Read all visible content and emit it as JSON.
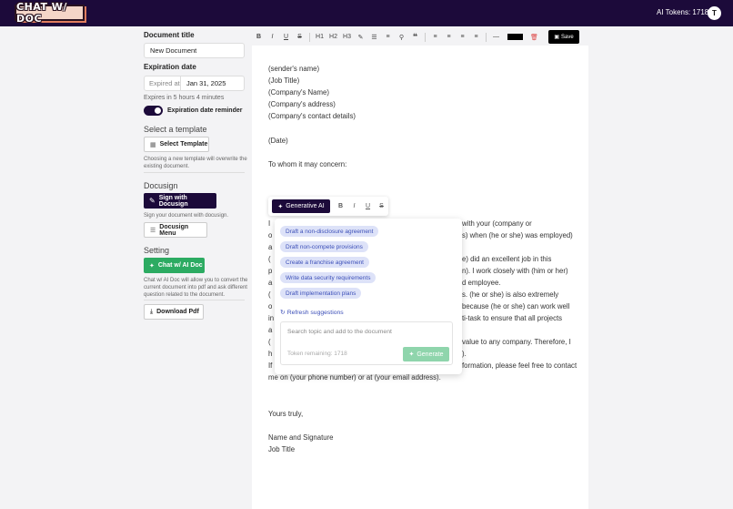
{
  "header": {
    "logo_text": "CHAT W/ DOC",
    "tokens_label": "AI Tokens: 1718",
    "avatar_initial": "T"
  },
  "sidebar": {
    "doc_title_label": "Document title",
    "doc_title_value": "New Document",
    "expiration_label": "Expiration date",
    "expired_at_label": "Expired at",
    "expiration_value": "Jan 31, 2025",
    "expires_in": "Expires in 5 hours 4 minutes",
    "reminder_label": "Expiration date reminder",
    "template_heading": "Select a template",
    "select_template_btn": "Select Template",
    "template_hint": "Choosing a new template will overwrite the existing document.",
    "docusign_heading": "Docusign",
    "sign_btn": "Sign with Docusign",
    "sign_hint": "Sign your document with docusign.",
    "docusign_menu_btn": "Docusign Menu",
    "setting_heading": "Setting",
    "chat_btn": "Chat w/ AI Doc",
    "chat_hint": "Chat w/ AI Doc will allow you to convert the current document into pdf and ask different question related to the document.",
    "download_btn": "Download Pdf"
  },
  "toolbar": {
    "bold": "B",
    "italic": "I",
    "underline": "U",
    "strike": "S",
    "h1": "H1",
    "h2": "H2",
    "h3": "H3",
    "quote": "❝",
    "minus": "—",
    "save_label": "Save"
  },
  "document": {
    "lines": [
      "(sender's name)",
      "(Job Title)",
      "(Company's Name)",
      "(Company's address)",
      "(Company's contact details)",
      "(Date)",
      "To whom it may concern:",
      "I",
      "o",
      "a",
      "(",
      "p",
      "a",
      "(",
      "o",
      "in",
      "a",
      "(",
      "h",
      "If",
      "me on (your phone number) or at (your email address).",
      "Yours truly,",
      "Name and Signature",
      "Job Title"
    ],
    "right_fragments": [
      "with your (company or",
      "s) when (he or she) was employed)",
      "e) did an excellent job in this",
      "n). I work closely with (him or her)",
      "d employee.",
      "s. (he or she) is also extremely",
      "because (he or she) can work well",
      "ti-task to ensure that all projects",
      "value to any company. Therefore, I",
      ").",
      "formation, please feel free to contact"
    ]
  },
  "ai": {
    "generative_label": "Generative AI",
    "bold": "B",
    "italic": "I",
    "underline": "U",
    "strike": "S",
    "suggestions": [
      "Draft a non-disclosure agreement",
      "Draft non-compete provisions",
      "Create a franchise agreement",
      "Write data security requirements",
      "Draft implementation plans"
    ],
    "refresh_label": "Refresh suggestions",
    "input_placeholder": "Search topic and add to the document",
    "tokens_remaining": "Token remaining: 1718",
    "generate_label": "Generate"
  },
  "colors": {
    "brand_dark": "#1c0a3a",
    "green": "#2cab62",
    "chip_bg": "#dde2f8",
    "chip_text": "#3c4fb8"
  }
}
